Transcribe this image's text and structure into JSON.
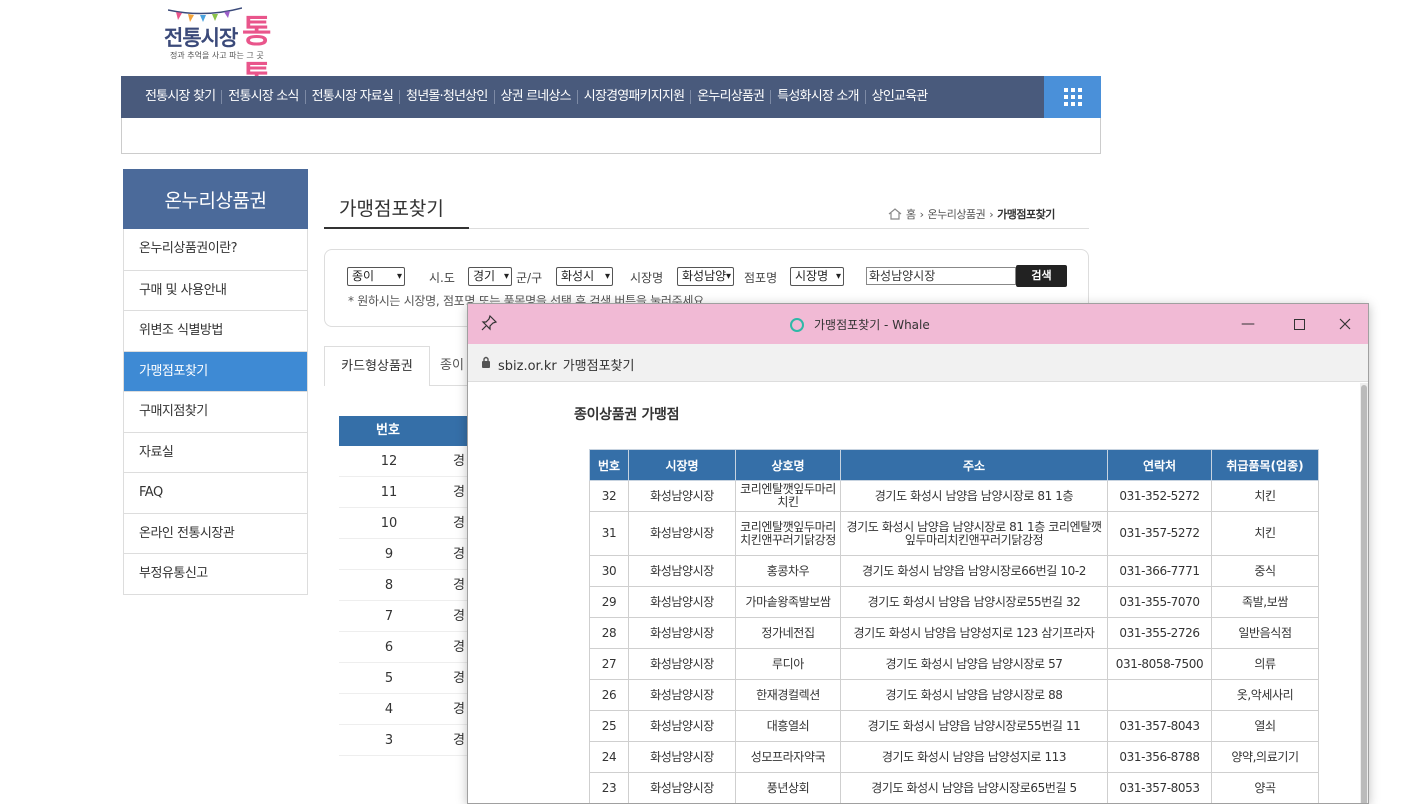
{
  "logo": {
    "main_text": "전통시장",
    "brand_text": "통통",
    "tagline": "정과 추억을 사고 파는 그 곳"
  },
  "topnav": {
    "items": [
      "전통시장 찾기",
      "전통시장 소식",
      "전통시장 자료실",
      "청년몰·청년상인",
      "상권 르네상스",
      "시장경영패키지지원",
      "온누리상품권",
      "특성화시장 소개",
      "상인교육관"
    ],
    "grid_icon": "grid-menu-icon"
  },
  "sidebar": {
    "title": "온누리상품권",
    "items": [
      "온누리상품권이란?",
      "구매 및 사용안내",
      "위변조 식별방법",
      "가맹점포찾기",
      "구매지점찾기",
      "자료실",
      "FAQ",
      "온라인 전통시장관",
      "부정유통신고"
    ],
    "active_index": 3
  },
  "main": {
    "title": "가맹점포찾기",
    "breadcrumb": {
      "home": "홈",
      "section": "온누리상품권",
      "current": "가맹점포찾기"
    }
  },
  "search": {
    "type_select": "종이",
    "sido_label": "시.도",
    "sido_select": "경기",
    "gungu_label": "군/구",
    "gungu_select": "화성시",
    "market_label": "시장명",
    "market_select": "화성남양",
    "store_label": "점포명",
    "store_select": "시장명",
    "query": "화성남양시장",
    "button": "검색",
    "note": "* 원하시는 시장명, 점포명 또는 품목명을 선택 후 검색 버튼을 눌러주세요"
  },
  "tabs": {
    "active": "카드형상품권",
    "other": "종이"
  },
  "bg_table": {
    "header": "번호",
    "rows": [
      {
        "num": "12",
        "col": "경"
      },
      {
        "num": "11",
        "col": "경"
      },
      {
        "num": "10",
        "col": "경"
      },
      {
        "num": "9",
        "col": "경"
      },
      {
        "num": "8",
        "col": "경"
      },
      {
        "num": "7",
        "col": "경"
      },
      {
        "num": "6",
        "col": "경"
      },
      {
        "num": "5",
        "col": "경"
      },
      {
        "num": "4",
        "col": "경"
      },
      {
        "num": "3",
        "col": "경"
      }
    ]
  },
  "popup": {
    "window_title": "가맹점포찾기 - Whale",
    "url_domain": "sbiz.or.kr",
    "url_title": "가맹점포찾기",
    "heading": "종이상품권 가맹점",
    "columns": [
      "번호",
      "시장명",
      "상호명",
      "주소",
      "연락처",
      "취급품목(업종)"
    ],
    "rows": [
      {
        "no": "32",
        "market": "화성남양시장",
        "name": "코리엔탈깻잎두마리치킨",
        "addr": "경기도 화성시 남양읍 남양시장로 81 1층",
        "tel": "031-352-5272",
        "item": "치킨"
      },
      {
        "no": "31",
        "market": "화성남양시장",
        "name": "코리엔탈깻잎두마리치킨앤꾸러기닭강정",
        "addr": "경기도 화성시 남양읍 남양시장로 81 1층 코리엔탈깻잎두마리치킨앤꾸러기닭강정",
        "tel": "031-357-5272",
        "item": "치킨"
      },
      {
        "no": "30",
        "market": "화성남양시장",
        "name": "홍콩차우",
        "addr": "경기도 화성시 남양읍 남양시장로66번길 10-2",
        "tel": "031-366-7771",
        "item": "중식"
      },
      {
        "no": "29",
        "market": "화성남양시장",
        "name": "가마솥왕족발보쌈",
        "addr": "경기도 화성시 남양읍 남양시장로55번길 32",
        "tel": "031-355-7070",
        "item": "족발,보쌈"
      },
      {
        "no": "28",
        "market": "화성남양시장",
        "name": "정가네전집",
        "addr": "경기도 화성시 남양읍 남양성지로 123 삼기프라자",
        "tel": "031-355-2726",
        "item": "일반음식점"
      },
      {
        "no": "27",
        "market": "화성남양시장",
        "name": "루디아",
        "addr": "경기도 화성시 남양읍 남양시장로 57",
        "tel": "031-8058-7500",
        "item": "의류"
      },
      {
        "no": "26",
        "market": "화성남양시장",
        "name": "한재경컬렉션",
        "addr": "경기도 화성시 남양읍 남양시장로 88",
        "tel": "",
        "item": "옷,악세사리"
      },
      {
        "no": "25",
        "market": "화성남양시장",
        "name": "대흥열쇠",
        "addr": "경기도 화성시 남양읍 남양시장로55번길 11",
        "tel": "031-357-8043",
        "item": "열쇠"
      },
      {
        "no": "24",
        "market": "화성남양시장",
        "name": "성모프라자약국",
        "addr": "경기도 화성시 남양읍 남양성지로 113",
        "tel": "031-356-8788",
        "item": "양약,의료기기"
      },
      {
        "no": "23",
        "market": "화성남양시장",
        "name": "풍년상회",
        "addr": "경기도 화성시 남양읍 남양시장로65번길 5",
        "tel": "031-357-8053",
        "item": "양곡"
      }
    ]
  }
}
